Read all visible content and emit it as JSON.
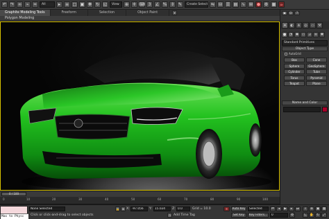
{
  "toolbar": {
    "filter_value": "All",
    "selection_set_placeholder": "Create Selection"
  },
  "ribbon": {
    "tabs": [
      "Graphite Modeling Tools",
      "Freeform",
      "Selection",
      "Object Paint"
    ],
    "sub_label": "Polygon Modeling"
  },
  "command_panel": {
    "dropdown_value": "Standard Primitives",
    "object_type_header": "Object Type",
    "autogrid_label": "AutoGrid",
    "primitives": [
      "Box",
      "Cone",
      "Sphere",
      "GeoSphere",
      "Cylinder",
      "Tube",
      "Torus",
      "Pyramid",
      "Teapot",
      "Plane"
    ],
    "name_color_header": "Name and Color",
    "color": "#a8002a"
  },
  "timeline": {
    "slider_label": "0 / 100",
    "ticks": [
      "0",
      "10",
      "20",
      "30",
      "40",
      "50",
      "60",
      "70",
      "80",
      "90",
      "100"
    ]
  },
  "status": {
    "maxscript_text": "Max to Physc",
    "selection_text": "None Selected",
    "prompt_text": "Click or click-and-drag to select objects",
    "x_label": "X:",
    "x_value": "-97.056",
    "y_label": "Y:",
    "y_value": "15.024",
    "z_label": "Z:",
    "z_value": "0.0",
    "grid_text": "Grid = 10.0",
    "auto_key": "Auto Key",
    "selected": "Selected",
    "set_key": "Set Key",
    "key_filters": "Key Filters...",
    "add_time_tag": "Add Time Tag",
    "frame_value": "0"
  },
  "colors": {
    "car_body": "#1fb51f",
    "viewport_border": "#d9c200",
    "accent": "#a8002a"
  }
}
